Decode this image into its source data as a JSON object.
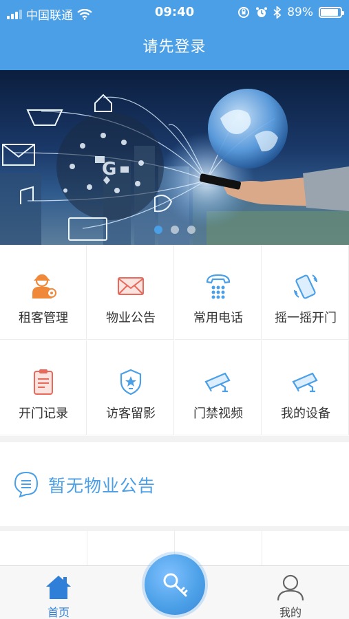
{
  "status_bar": {
    "carrier": "中国联通",
    "time": "09:40",
    "battery_percent": "89%",
    "battery_level": 0.89
  },
  "navbar": {
    "title": "请先登录"
  },
  "banner": {
    "page_count": 3,
    "active_page": 1
  },
  "menu": [
    {
      "label": "租客管理",
      "icon": "tenant-manage-icon"
    },
    {
      "label": "物业公告",
      "icon": "envelope-icon"
    },
    {
      "label": "常用电话",
      "icon": "telephone-icon"
    },
    {
      "label": "摇一摇开门",
      "icon": "shake-phone-icon"
    },
    {
      "label": "开门记录",
      "icon": "clipboard-icon"
    },
    {
      "label": "访客留影",
      "icon": "shield-badge-icon"
    },
    {
      "label": "门禁视频",
      "icon": "cctv-camera-icon"
    },
    {
      "label": "我的设备",
      "icon": "cctv-camera-icon"
    }
  ],
  "notice": {
    "text": "暂无物业公告",
    "icon": "chat-bubble-icon"
  },
  "tabbar": {
    "home_label": "首页",
    "mine_label": "我的",
    "center_icon": "key-icon"
  },
  "colors": {
    "accent": "#4a9fe6",
    "tenant_orange": "#f0883a",
    "notice_red": "#e9685c"
  }
}
